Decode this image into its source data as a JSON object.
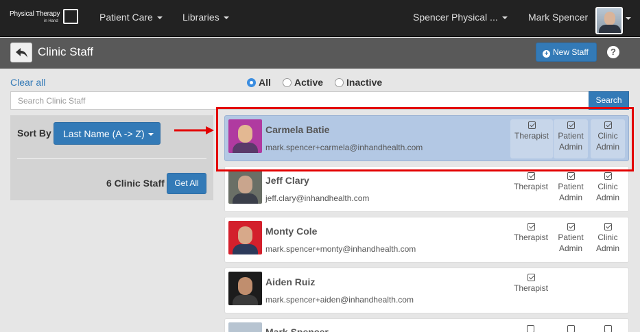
{
  "navbar": {
    "logo_line1": "Physical Therapy",
    "logo_line2": "in Hand",
    "menu": [
      {
        "label": "Patient Care"
      },
      {
        "label": "Libraries"
      }
    ],
    "clinic_selector": "Spencer Physical ...",
    "user_name": "Mark Spencer"
  },
  "subheader": {
    "title": "Clinic Staff",
    "new_staff_label": "New Staff",
    "help_label": "?"
  },
  "filters": {
    "clear_all": "Clear all",
    "options": [
      {
        "label": "All",
        "selected": true
      },
      {
        "label": "Active",
        "selected": false
      },
      {
        "label": "Inactive",
        "selected": false
      }
    ],
    "search_placeholder": "Search Clinic Staff",
    "search_button": "Search"
  },
  "left_panel": {
    "sort_label": "Sort By",
    "sort_value": "Last Name (A -> Z)",
    "count_label": "6 Clinic Staff",
    "get_all_label": "Get All"
  },
  "roles": {
    "therapist": "Therapist",
    "patient_admin_1": "Patient",
    "patient_admin_2": "Admin",
    "clinic_admin_1": "Clinic",
    "clinic_admin_2": "Admin"
  },
  "staff": [
    {
      "name": "Carmela Batie",
      "email": "mark.spencer+carmela@inhandhealth.com",
      "selected": true,
      "roles": [
        "therapist",
        "patient_admin",
        "clinic_admin"
      ]
    },
    {
      "name": "Jeff Clary",
      "email": "jeff.clary@inhandhealth.com",
      "selected": false,
      "roles": [
        "therapist",
        "patient_admin",
        "clinic_admin"
      ]
    },
    {
      "name": "Monty Cole",
      "email": "mark.spencer+monty@inhandhealth.com",
      "selected": false,
      "roles": [
        "therapist",
        "patient_admin",
        "clinic_admin"
      ]
    },
    {
      "name": "Aiden Ruiz",
      "email": "mark.spencer+aiden@inhandhealth.com",
      "selected": false,
      "roles": [
        "therapist"
      ]
    },
    {
      "name": "Mark Spencer",
      "email": "",
      "selected": false,
      "roles": [
        "therapist",
        "patient_admin",
        "clinic_admin"
      ]
    }
  ],
  "colors": {
    "primary": "#337ab7",
    "navbar": "#222222",
    "subbar": "#595959",
    "selected_row": "#b3c8e4",
    "annotation_red": "#e30000"
  }
}
